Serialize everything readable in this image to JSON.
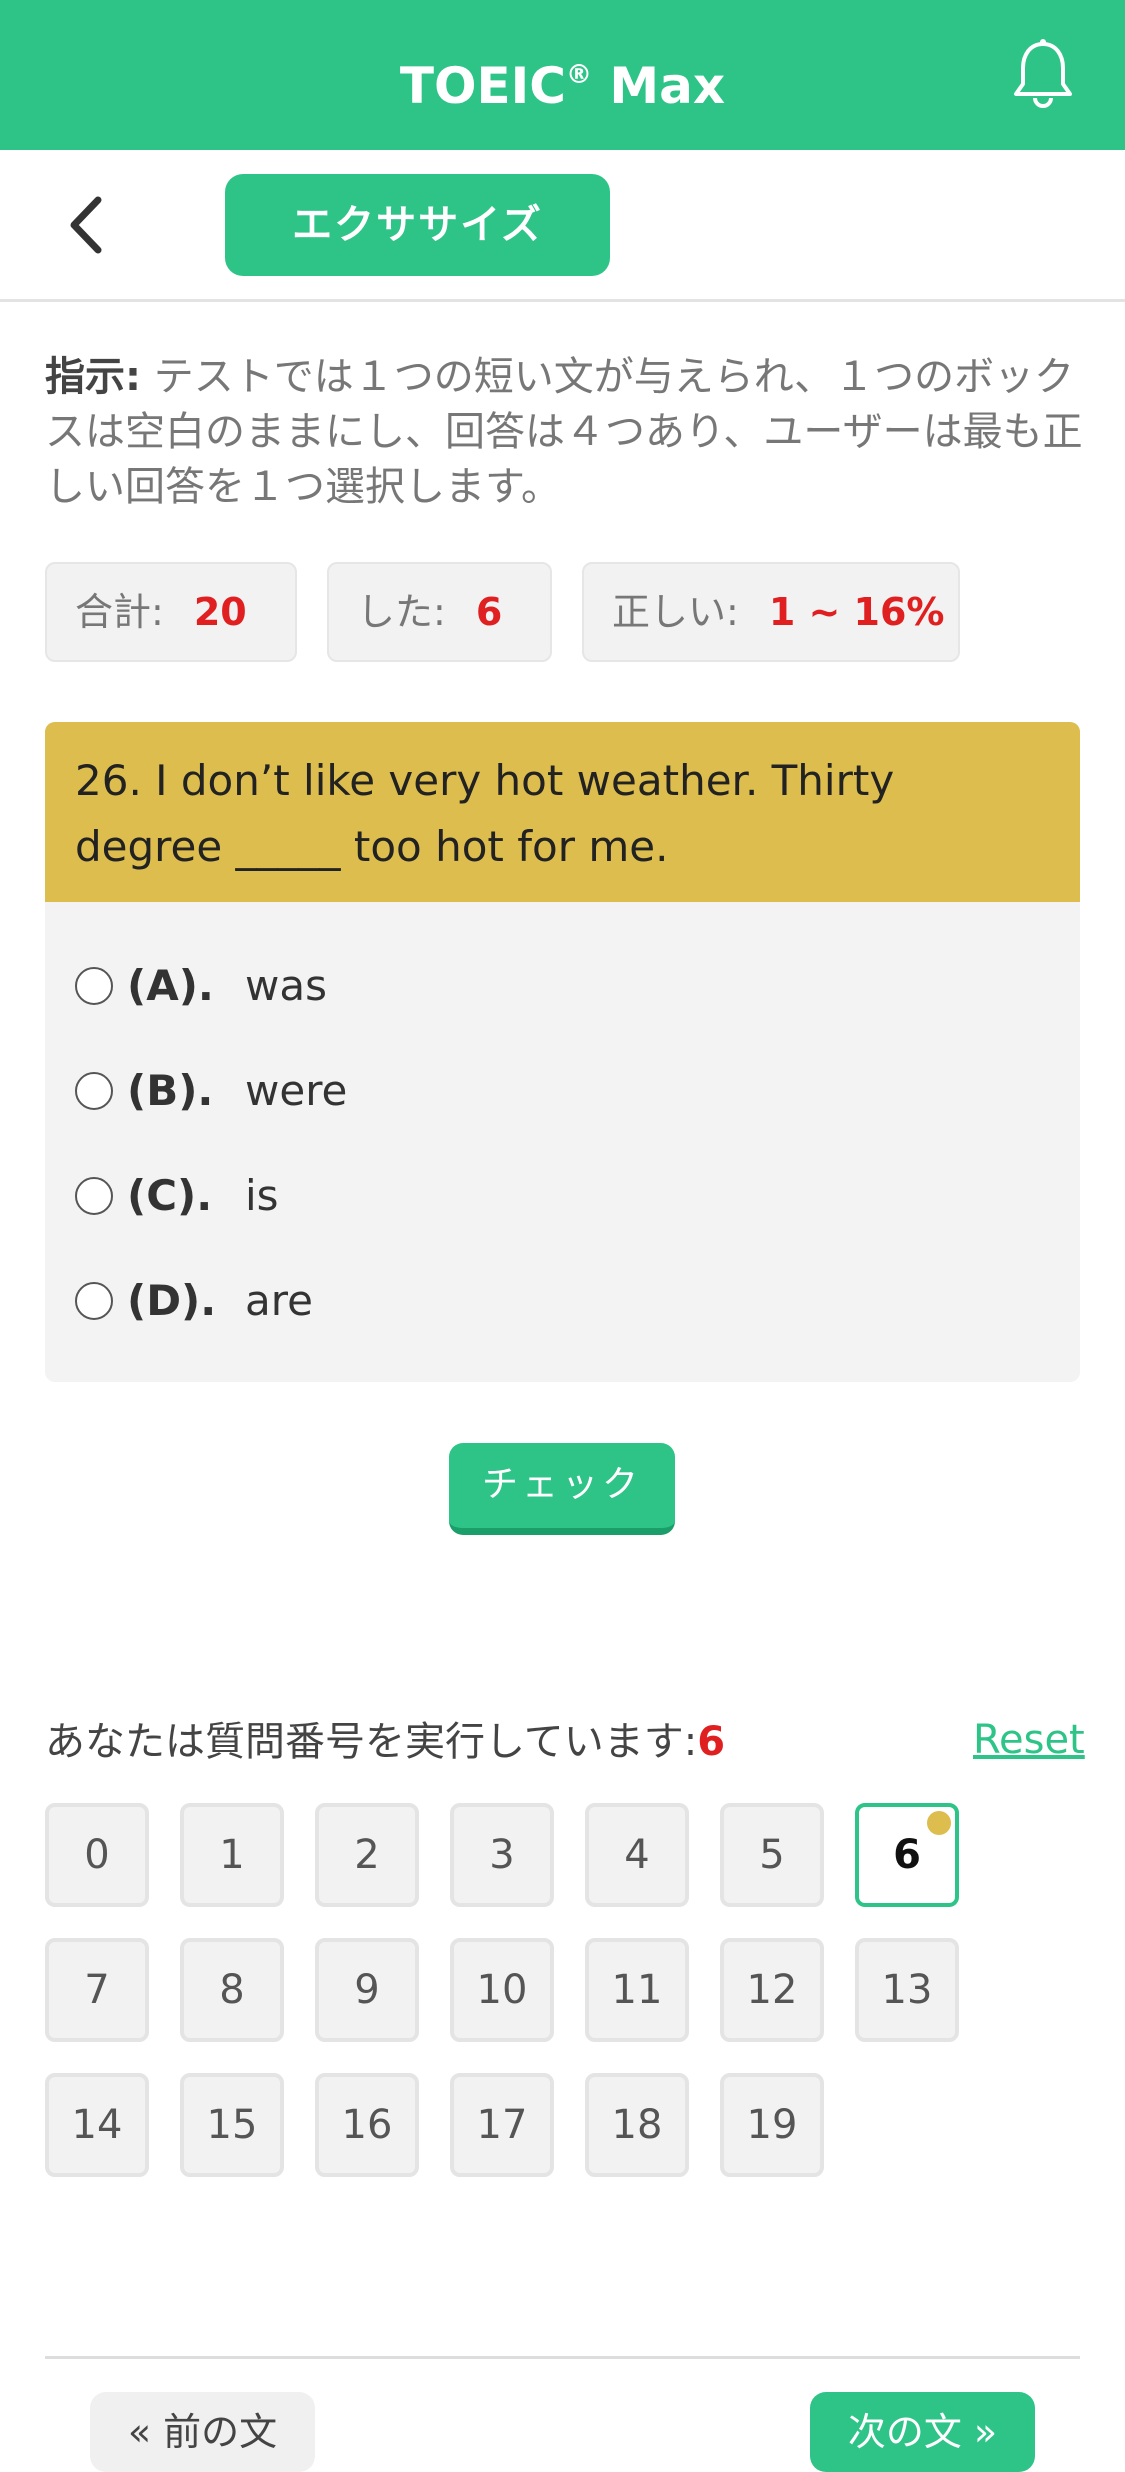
{
  "header": {
    "title": "TOEIC",
    "title_mark": "®",
    "title_suffix": " Max",
    "bell_icon": "bell-icon",
    "color": "#2ec488"
  },
  "subbar": {
    "back_icon": "chevron-left-icon",
    "exercise_label": "エクササイズ"
  },
  "instructions": {
    "label": "指示:",
    "text": " テストでは１つの短い文が与えられ、１つのボックスは空白のままにし、回答は４つあり、ユーザーは最も正しい回答を１つ選択します。"
  },
  "stats": {
    "total_label": "合計:",
    "total_value": "20",
    "done_label": "した:",
    "done_value": "6",
    "correct_label": "正しい:",
    "correct_value": "1 ~ 16%"
  },
  "question": {
    "text": "26. I don’t like very hot weather. Thirty degree _____ too hot for me.",
    "options": [
      {
        "letter": "(A).",
        "text": "was"
      },
      {
        "letter": "(B).",
        "text": "were"
      },
      {
        "letter": "(C).",
        "text": "is"
      },
      {
        "letter": "(D).",
        "text": "are"
      }
    ]
  },
  "check_label": "チェック",
  "progress": {
    "running_label": "あなたは質問番号を実行しています:",
    "current": "6",
    "reset_label": "Reset",
    "numbers": [
      "0",
      "1",
      "2",
      "3",
      "4",
      "5",
      "6",
      "7",
      "8",
      "9",
      "10",
      "11",
      "12",
      "13",
      "14",
      "15",
      "16",
      "17",
      "18",
      "19"
    ],
    "active_index": 6
  },
  "nav": {
    "prev_label": "« 前の文",
    "next_label": "次の文 »"
  }
}
